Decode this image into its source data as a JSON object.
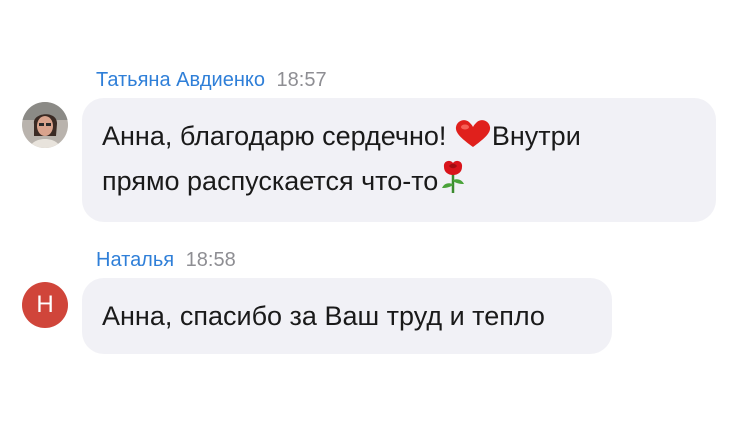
{
  "messages": [
    {
      "author": "Татьяна Авдиенко",
      "time": "18:57",
      "avatar": {
        "type": "photo"
      },
      "text_line1_part1": "Анна, благодарю сердечно!",
      "text_line1_part2": "Внутри",
      "text_line2": "прямо распускается что-то",
      "emojis": [
        "heart-emoji",
        "rose-emoji"
      ]
    },
    {
      "author": "Наталья",
      "time": "18:58",
      "avatar": {
        "type": "letter",
        "letter": "Н",
        "color": "#d0453a"
      },
      "text": "Анна, спасибо за Ваш труд и тепло"
    }
  ],
  "colors": {
    "author": "#2f7fd8",
    "time": "#8e8e93",
    "bubble": "#f1f1f6",
    "text": "#1a1a1a"
  }
}
